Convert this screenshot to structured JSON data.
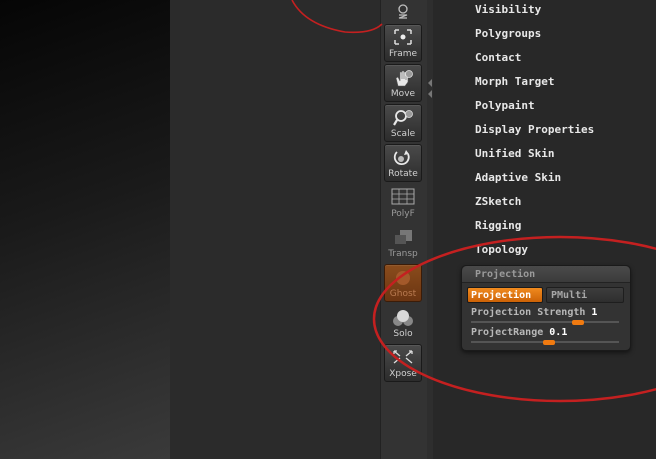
{
  "shelf": {
    "symmetry_icon": "symmetry-xyz-icon",
    "buttons": [
      {
        "label": "Frame",
        "icon": "frame-icon"
      },
      {
        "label": "Move",
        "icon": "move-hand-icon"
      },
      {
        "label": "Scale",
        "icon": "scale-magnifier-icon"
      },
      {
        "label": "Rotate",
        "icon": "rotate-icon"
      },
      {
        "label": "PolyF",
        "icon": "polyframe-grid-icon"
      },
      {
        "label": "Transp",
        "icon": "transparency-icon"
      },
      {
        "label": "Ghost",
        "icon": "ghost-icon"
      },
      {
        "label": "Solo",
        "icon": "solo-icon"
      },
      {
        "label": "Xpose",
        "icon": "xpose-arrows-icon"
      }
    ]
  },
  "palette": {
    "items": [
      "Visibility",
      "Polygroups",
      "Contact",
      "Morph Target",
      "Polypaint",
      "Display Properties",
      "Unified Skin",
      "Adaptive Skin",
      "ZSketch",
      "Rigging",
      "Topology"
    ]
  },
  "projection": {
    "title": "Projection",
    "toggle_projection_label": "Projection",
    "toggle_pmulti_label": "PMulti",
    "projection_active": true,
    "strength": {
      "label": "Projection Strength",
      "value": "1",
      "fraction": 1.0
    },
    "range": {
      "label": "ProjectRange",
      "value": "0.1",
      "fraction": 0.1
    }
  },
  "colors": {
    "accent_orange": "#f07a10",
    "annotation_red": "#c42020",
    "palette_bg": "#282828"
  }
}
